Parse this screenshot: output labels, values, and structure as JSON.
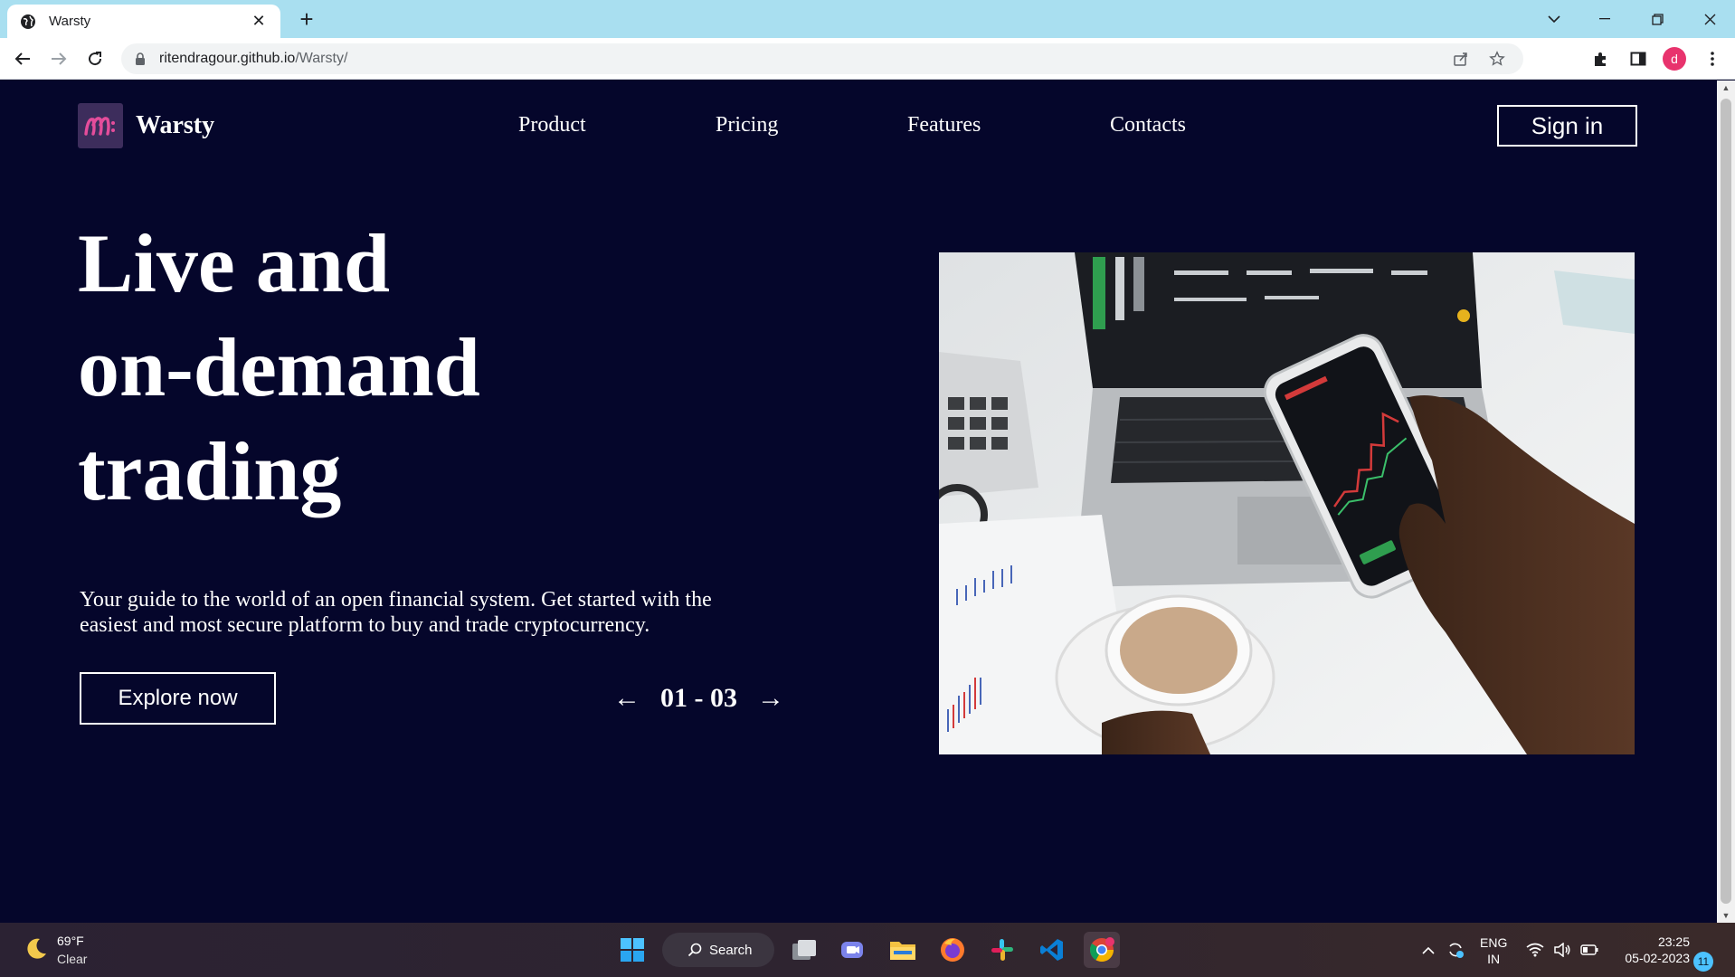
{
  "browser": {
    "tab_title": "Warsty",
    "url_host": "ritendragour.github.io",
    "url_path": "/Warsty/",
    "profile_initial": "d"
  },
  "site": {
    "brand": "Warsty",
    "nav": [
      "Product",
      "Pricing",
      "Features",
      "Contacts"
    ],
    "signin_label": "Sign in",
    "hero_title_lines": [
      "Live and",
      "on-demand",
      "trading"
    ],
    "hero_description": "Your guide to the world of an open financial system. Get started with the easiest and most secure platform to buy and trade cryptocurrency.",
    "explore_label": "Explore now",
    "pager": {
      "prev": "←",
      "label": "01 - 03",
      "next": "→"
    },
    "accent": "#e44d9b",
    "background": "#05062b"
  },
  "taskbar": {
    "weather_temp": "69°F",
    "weather_condition": "Clear",
    "search_label": "Search",
    "lang_line1": "ENG",
    "lang_line2": "IN",
    "time": "23:25",
    "date": "05-02-2023",
    "notification_count": "11"
  }
}
